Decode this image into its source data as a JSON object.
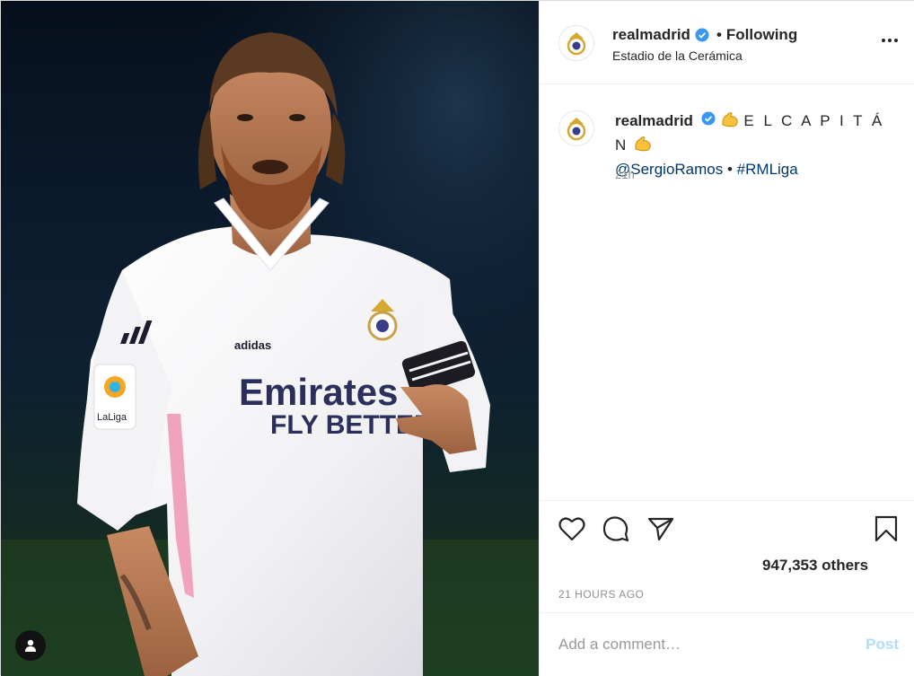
{
  "post": {
    "author": "realmadrid",
    "follow_state": "Following",
    "location": "Estadio de la Cerámica",
    "caption": {
      "text": "E L C A P I T Á N",
      "mention": "@SergioRamos",
      "separator": "•",
      "hashtag": "#RMLiga",
      "age": "21h"
    },
    "likes_text": "947,353 others",
    "timestamp": "21 HOURS AGO",
    "comment_placeholder": "Add a comment…",
    "post_label": "Post"
  },
  "jersey": {
    "sponsor_line1": "Emirates",
    "sponsor_line2": "FLY BETTER",
    "brand": "adidas",
    "sleeve_badge": "LaLiga"
  },
  "colors": {
    "verified": "#3897f0",
    "link": "#00376b",
    "post_disabled": "#b3dbff",
    "muted": "#8e8e8e"
  },
  "icons": [
    "more-options-icon",
    "like-heart-icon",
    "comment-icon",
    "share-icon",
    "save-bookmark-icon",
    "user-tags-icon",
    "verified-badge-icon",
    "flexed-biceps-emoji"
  ]
}
